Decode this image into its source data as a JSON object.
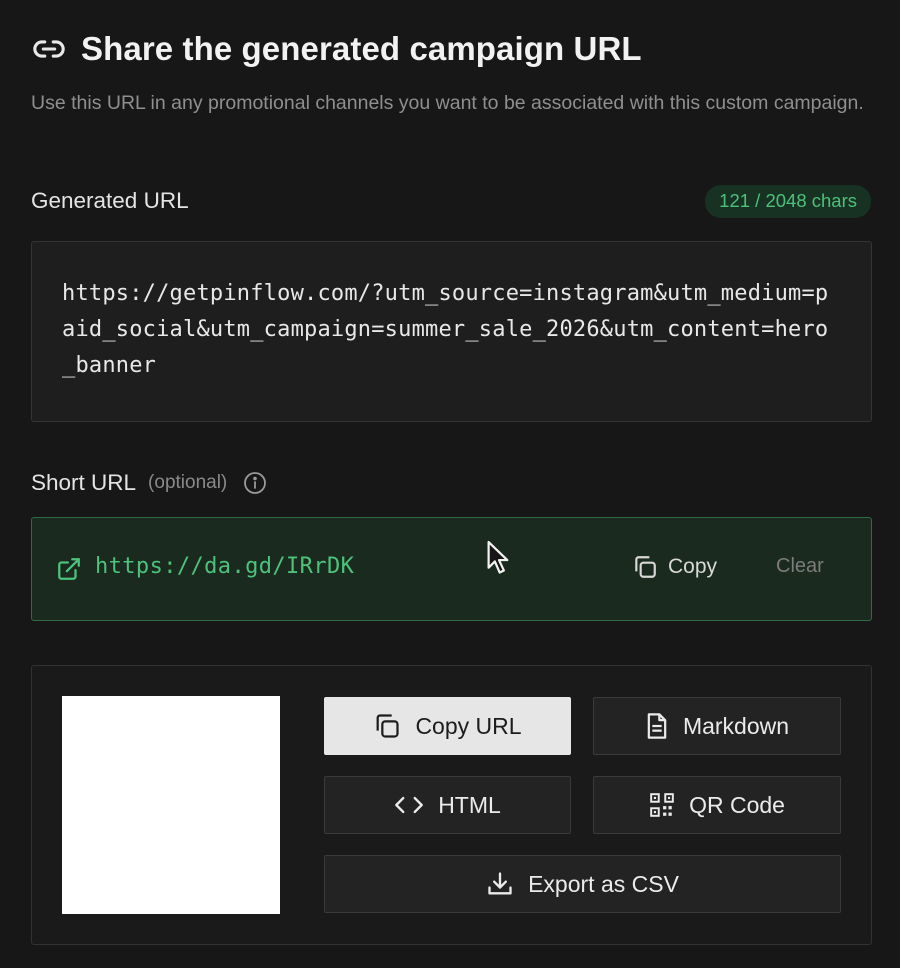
{
  "header": {
    "icon": "link-icon",
    "title": "Share the generated campaign URL",
    "description": "Use this URL in any promotional channels you want to be associated with this custom campaign."
  },
  "generated": {
    "label": "Generated URL",
    "char_count": "121 / 2048 chars",
    "url": "https://getpinflow.com/?utm_source=instagram&utm_medium=paid_social&utm_campaign=summer_sale_2026&utm_content=hero_banner"
  },
  "short": {
    "label": "Short URL",
    "optional": "(optional)",
    "url": "https://da.gd/IRrDK",
    "copy_label": "Copy",
    "clear_label": "Clear"
  },
  "export": {
    "buttons": {
      "copy_url": "Copy URL",
      "markdown": "Markdown",
      "html": "HTML",
      "qr_code": "QR Code",
      "csv": "Export as CSV"
    }
  },
  "colors": {
    "accent_green": "#4cc27b",
    "background": "#171717"
  }
}
